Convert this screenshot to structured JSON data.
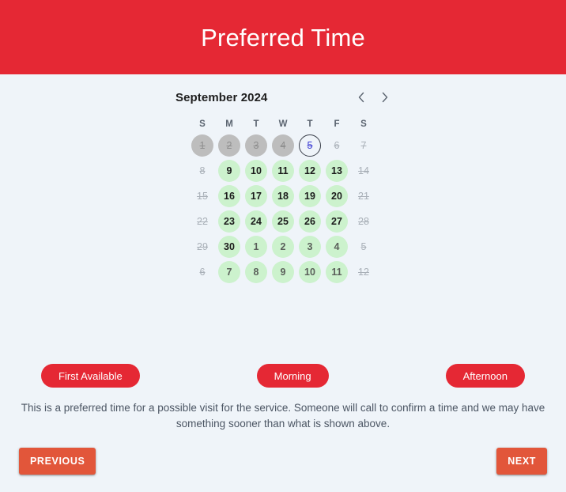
{
  "header": {
    "title": "Preferred Time",
    "background": "#e52834",
    "text_color": "#ffffff"
  },
  "calendar": {
    "month_label": "September 2024",
    "prev_icon": "chevron-left-icon",
    "next_icon": "chevron-right-icon",
    "weekdays": [
      "S",
      "M",
      "T",
      "W",
      "T",
      "F",
      "S"
    ],
    "colors": {
      "available": "#ccf2cd",
      "blocked": "#bdbdbd",
      "today_ring": "#3a3f4a",
      "today_text": "#3b3bd4"
    },
    "weeks": [
      [
        {
          "day": "1",
          "state": "blocked"
        },
        {
          "day": "2",
          "state": "blocked"
        },
        {
          "day": "3",
          "state": "blocked"
        },
        {
          "day": "4",
          "state": "blocked"
        },
        {
          "day": "5",
          "state": "today"
        },
        {
          "day": "6",
          "state": "off"
        },
        {
          "day": "7",
          "state": "off"
        }
      ],
      [
        {
          "day": "8",
          "state": "off"
        },
        {
          "day": "9",
          "state": "available"
        },
        {
          "day": "10",
          "state": "available"
        },
        {
          "day": "11",
          "state": "available"
        },
        {
          "day": "12",
          "state": "available"
        },
        {
          "day": "13",
          "state": "available"
        },
        {
          "day": "14",
          "state": "off"
        }
      ],
      [
        {
          "day": "15",
          "state": "off"
        },
        {
          "day": "16",
          "state": "available"
        },
        {
          "day": "17",
          "state": "available"
        },
        {
          "day": "18",
          "state": "available"
        },
        {
          "day": "19",
          "state": "available"
        },
        {
          "day": "20",
          "state": "available"
        },
        {
          "day": "21",
          "state": "off"
        }
      ],
      [
        {
          "day": "22",
          "state": "off"
        },
        {
          "day": "23",
          "state": "available"
        },
        {
          "day": "24",
          "state": "available"
        },
        {
          "day": "25",
          "state": "available"
        },
        {
          "day": "26",
          "state": "available"
        },
        {
          "day": "27",
          "state": "available"
        },
        {
          "day": "28",
          "state": "off"
        }
      ],
      [
        {
          "day": "29",
          "state": "off"
        },
        {
          "day": "30",
          "state": "available"
        },
        {
          "day": "1",
          "state": "available-other"
        },
        {
          "day": "2",
          "state": "available-other"
        },
        {
          "day": "3",
          "state": "available-other"
        },
        {
          "day": "4",
          "state": "available-other"
        },
        {
          "day": "5",
          "state": "off"
        }
      ],
      [
        {
          "day": "6",
          "state": "off"
        },
        {
          "day": "7",
          "state": "available-other"
        },
        {
          "day": "8",
          "state": "available-other"
        },
        {
          "day": "9",
          "state": "available-other"
        },
        {
          "day": "10",
          "state": "available-other"
        },
        {
          "day": "11",
          "state": "available-other"
        },
        {
          "day": "12",
          "state": "off"
        }
      ]
    ]
  },
  "time_options": [
    {
      "label": "First Available"
    },
    {
      "label": "Morning"
    },
    {
      "label": "Afternoon"
    }
  ],
  "note": "This is a preferred time for a possible visit for the service. Someone will call to confirm a time and we may have something sooner than what is shown above.",
  "footer": {
    "previous_label": "PREVIOUS",
    "next_label": "NEXT",
    "button_color": "#e2563a"
  }
}
